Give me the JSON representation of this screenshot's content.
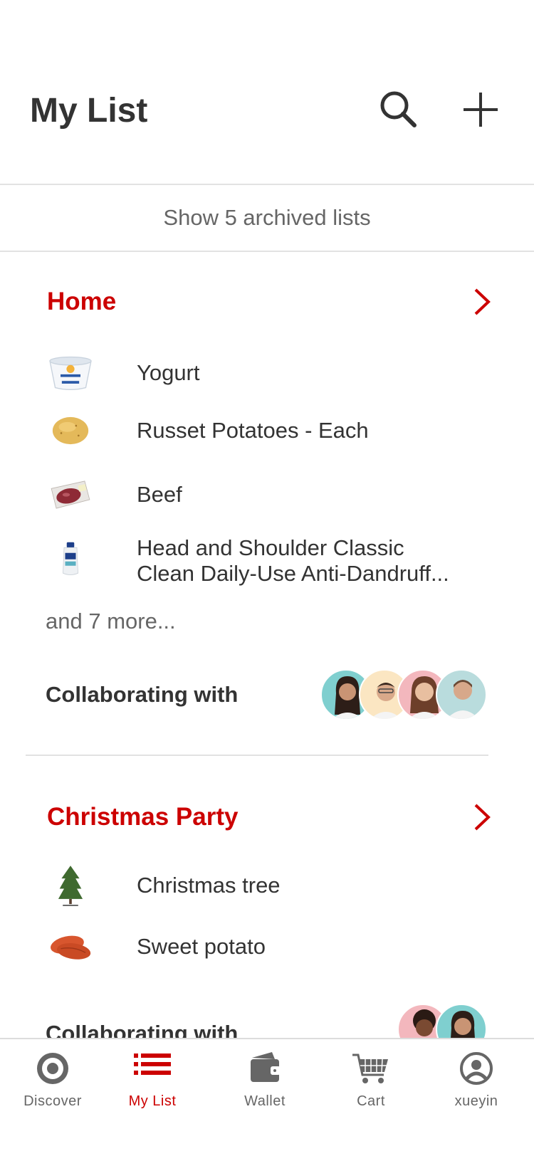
{
  "header": {
    "title": "My List",
    "search_icon": "search-icon",
    "add_icon": "plus-icon"
  },
  "archived": {
    "label": "Show 5 archived lists"
  },
  "lists": [
    {
      "name": "Home",
      "items": [
        {
          "name": "Yogurt",
          "thumb": "yogurt-cup"
        },
        {
          "name": "Russet Potatoes - Each",
          "thumb": "potato"
        },
        {
          "name": "Beef",
          "thumb": "beef-pack"
        },
        {
          "name": "Head and Shoulder Classic Clean Daily-Use Anti-Dandruff...",
          "thumb": "shampoo-bottle"
        }
      ],
      "more": "and 7 more...",
      "collab_label": "Collaborating with",
      "collaborators": [
        "avatar-1",
        "avatar-2",
        "avatar-3",
        "avatar-4"
      ]
    },
    {
      "name": "Christmas Party",
      "items": [
        {
          "name": "Christmas tree",
          "thumb": "christmas-tree"
        },
        {
          "name": "Sweet potato",
          "thumb": "sweet-potato"
        }
      ],
      "collab_label": "Collaborating with",
      "collaborators": [
        "avatar-5",
        "avatar-6"
      ]
    }
  ],
  "tabs": [
    {
      "label": "Discover",
      "icon": "target-icon",
      "active": false
    },
    {
      "label": "My List",
      "icon": "list-icon",
      "active": true
    },
    {
      "label": "Wallet",
      "icon": "wallet-icon",
      "active": false
    },
    {
      "label": "Cart",
      "icon": "cart-icon",
      "active": false
    },
    {
      "label": "xueyin",
      "icon": "account-icon",
      "active": false
    }
  ],
  "colors": {
    "accent": "#cc0000",
    "text": "#333333",
    "muted": "#666666",
    "divider": "#e2e2e2"
  }
}
